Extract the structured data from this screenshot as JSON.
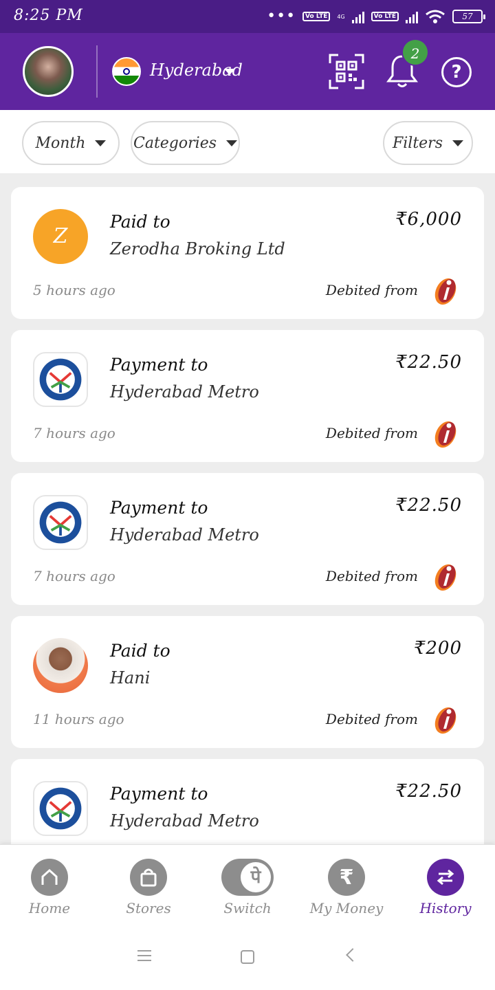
{
  "status_bar": {
    "time": "8:25 PM",
    "dots": "•••",
    "volte1": "Vo LTE",
    "net1": "4G",
    "volte2": "Vo LTE",
    "battery": "57"
  },
  "header": {
    "city": "Hyderabad",
    "notification_count": "2",
    "help_label": "?"
  },
  "filters": {
    "month": "Month",
    "categories": "Categories",
    "filters": "Filters"
  },
  "transactions": [
    {
      "type": "Paid to",
      "payee": "Zerodha Broking Ltd",
      "amount": "₹6,000",
      "time": "5 hours ago",
      "debit_label": "Debited from",
      "icon_letter": "Z",
      "icon": "zerodha-logo"
    },
    {
      "type": "Payment to",
      "payee": "Hyderabad Metro",
      "amount": "₹22.50",
      "time": "7 hours ago",
      "debit_label": "Debited from",
      "icon": "hyderabad-metro-logo"
    },
    {
      "type": "Payment to",
      "payee": "Hyderabad Metro",
      "amount": "₹22.50",
      "time": "7 hours ago",
      "debit_label": "Debited from",
      "icon": "hyderabad-metro-logo"
    },
    {
      "type": "Paid to",
      "payee": "Hani",
      "amount": "₹200",
      "time": "11 hours ago",
      "debit_label": "Debited from",
      "icon": "contact-avatar"
    },
    {
      "type": "Payment to",
      "payee": "Hyderabad Metro",
      "amount": "₹22.50",
      "time": "",
      "debit_label": "",
      "icon": "hyderabad-metro-logo"
    }
  ],
  "bottom_nav": {
    "home": "Home",
    "stores": "Stores",
    "switch": "Switch",
    "switch_glyph": "पे",
    "my_money": "My Money",
    "my_money_glyph": "₹",
    "history": "History"
  },
  "colors": {
    "brand_purple": "#5f259f",
    "status_bar": "#4a1d86",
    "zerodha_orange": "#f7a427",
    "icici_red": "#b02a30",
    "icici_orange": "#f37e20",
    "badge_green": "#43a047"
  }
}
